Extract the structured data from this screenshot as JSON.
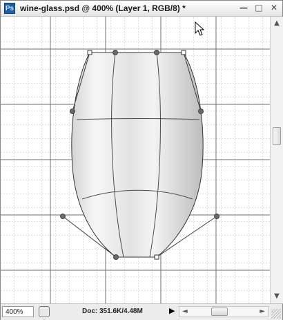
{
  "window": {
    "title": "wine-glass.psd @ 400% (Layer 1, RGB/8) *",
    "app_icon_label": "Ps",
    "controls": {
      "minimize": "—",
      "maximize": "□",
      "close": "✕"
    }
  },
  "canvas": {
    "object": "wine-glass-warp-mesh",
    "grid": true
  },
  "statusbar": {
    "zoom": "400%",
    "doc_info": "Doc: 351.6K/4.48M",
    "arrow": "▶"
  },
  "scrollbars": {
    "vertical": {
      "up": "▲",
      "down": "▼"
    },
    "horizontal": {
      "left": "◄",
      "right": "►"
    }
  },
  "colors": {
    "accent": "#1f5fa8",
    "grid_major": "#6e6e6e",
    "grid_minor": "#bdbdbd",
    "handle": "#6a6a6a"
  }
}
